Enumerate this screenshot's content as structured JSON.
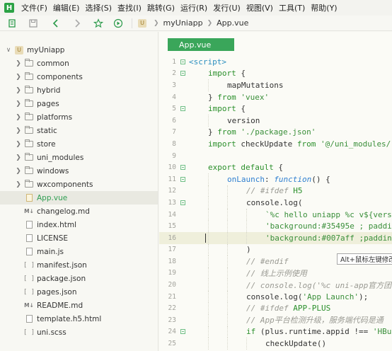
{
  "menubar": {
    "logo": "H",
    "items": [
      "文件(F)",
      "编辑(E)",
      "选择(S)",
      "查找(I)",
      "跳转(G)",
      "运行(R)",
      "发行(U)",
      "视图(V)",
      "工具(T)",
      "帮助(Y)"
    ]
  },
  "toolbar": {
    "icons": [
      "bookmark-icon",
      "save-icon",
      "back-arrow-icon",
      "forward-arrow-icon",
      "star-icon",
      "run-icon"
    ],
    "breadcrumb": {
      "badge": "U",
      "project": "myUniapp",
      "file": "App.vue"
    }
  },
  "sidebar": {
    "root": {
      "label": "myUniapp",
      "expanded": true
    },
    "folders": [
      "common",
      "components",
      "hybrid",
      "pages",
      "platforms",
      "static",
      "store",
      "uni_modules",
      "windows",
      "wxcomponents"
    ],
    "files": [
      {
        "label": "App.vue",
        "icon": "vue-file-icon",
        "selected": true
      },
      {
        "label": "changelog.md",
        "icon": "markdown-file-icon"
      },
      {
        "label": "index.html",
        "icon": "html-file-icon"
      },
      {
        "label": "LICENSE",
        "icon": "file-icon"
      },
      {
        "label": "main.js",
        "icon": "js-file-icon"
      },
      {
        "label": "manifest.json",
        "icon": "json-file-icon"
      },
      {
        "label": "package.json",
        "icon": "json-file-icon"
      },
      {
        "label": "pages.json",
        "icon": "json-file-icon"
      },
      {
        "label": "README.md",
        "icon": "markdown-file-icon"
      },
      {
        "label": "template.h5.html",
        "icon": "html-file-icon"
      },
      {
        "label": "uni.scss",
        "icon": "scss-file-icon"
      }
    ]
  },
  "editor": {
    "tab_label": "App.vue",
    "tooltip": "Alt+鼠标左键修改",
    "current_line": 16,
    "lines": [
      {
        "n": 1,
        "fold": true,
        "indent": 0,
        "parts": [
          [
            "tag",
            "<script>"
          ]
        ]
      },
      {
        "n": 2,
        "fold": true,
        "indent": 1,
        "parts": [
          [
            "kw",
            "import"
          ],
          [
            "txt",
            " {"
          ]
        ]
      },
      {
        "n": 3,
        "fold": false,
        "indent": 2,
        "parts": [
          [
            "txt",
            "mapMutations"
          ]
        ]
      },
      {
        "n": 4,
        "fold": false,
        "indent": 1,
        "parts": [
          [
            "txt",
            "} "
          ],
          [
            "kw",
            "from"
          ],
          [
            "txt",
            " "
          ],
          [
            "str",
            "'vuex'"
          ]
        ]
      },
      {
        "n": 5,
        "fold": true,
        "indent": 1,
        "parts": [
          [
            "kw",
            "import"
          ],
          [
            "txt",
            " {"
          ]
        ]
      },
      {
        "n": 6,
        "fold": false,
        "indent": 2,
        "parts": [
          [
            "txt",
            "version"
          ]
        ]
      },
      {
        "n": 7,
        "fold": false,
        "indent": 1,
        "parts": [
          [
            "txt",
            "} "
          ],
          [
            "kw",
            "from"
          ],
          [
            "txt",
            " "
          ],
          [
            "str",
            "'./package.json'"
          ]
        ]
      },
      {
        "n": 8,
        "fold": false,
        "indent": 1,
        "parts": [
          [
            "kw",
            "import"
          ],
          [
            "txt",
            " checkUpdate "
          ],
          [
            "kw",
            "from"
          ],
          [
            "txt",
            " "
          ],
          [
            "str",
            "'@/uni_modules/"
          ]
        ]
      },
      {
        "n": 9,
        "fold": false,
        "indent": 0,
        "parts": []
      },
      {
        "n": 10,
        "fold": true,
        "indent": 1,
        "parts": [
          [
            "kw",
            "export"
          ],
          [
            "txt",
            " "
          ],
          [
            "kw",
            "default"
          ],
          [
            "txt",
            " {"
          ]
        ]
      },
      {
        "n": 11,
        "fold": true,
        "indent": 2,
        "parts": [
          [
            "def",
            "onLaunch"
          ],
          [
            "txt",
            ": "
          ],
          [
            "fn",
            "function"
          ],
          [
            "txt",
            "() {"
          ]
        ]
      },
      {
        "n": 12,
        "fold": false,
        "indent": 3,
        "parts": [
          [
            "com",
            "// #ifdef "
          ],
          [
            "kw",
            "H5"
          ]
        ]
      },
      {
        "n": 13,
        "fold": true,
        "indent": 3,
        "parts": [
          [
            "txt",
            "console.log("
          ]
        ]
      },
      {
        "n": 14,
        "fold": false,
        "indent": 4,
        "parts": [
          [
            "str",
            "`%c hello uniapp %c v${vers"
          ]
        ]
      },
      {
        "n": 15,
        "fold": false,
        "indent": 4,
        "parts": [
          [
            "str",
            "'background:#35495e ; paddi"
          ]
        ]
      },
      {
        "n": 16,
        "fold": false,
        "indent": 4,
        "parts": [
          [
            "str",
            "'background:#007aff ;paddin"
          ]
        ]
      },
      {
        "n": 17,
        "fold": false,
        "indent": 3,
        "parts": [
          [
            "txt",
            ")"
          ]
        ]
      },
      {
        "n": 18,
        "fold": false,
        "indent": 3,
        "parts": [
          [
            "com",
            "// #endif"
          ]
        ]
      },
      {
        "n": 19,
        "fold": false,
        "indent": 3,
        "parts": [
          [
            "com",
            "// 线上示例使用"
          ]
        ]
      },
      {
        "n": 20,
        "fold": false,
        "indent": 3,
        "parts": [
          [
            "com",
            "// console.log('%c uni-app官方团"
          ]
        ]
      },
      {
        "n": 21,
        "fold": false,
        "indent": 3,
        "parts": [
          [
            "txt",
            "console.log("
          ],
          [
            "str",
            "'App Launch'"
          ],
          [
            "txt",
            ");"
          ]
        ]
      },
      {
        "n": 22,
        "fold": false,
        "indent": 3,
        "parts": [
          [
            "com",
            "// #ifdef "
          ],
          [
            "kw",
            "APP-PLUS"
          ]
        ]
      },
      {
        "n": 23,
        "fold": false,
        "indent": 3,
        "parts": [
          [
            "com",
            "// App平台检测升级，服务端代码是通"
          ]
        ]
      },
      {
        "n": 24,
        "fold": true,
        "indent": 3,
        "parts": [
          [
            "kw",
            "if"
          ],
          [
            "txt",
            " (plus.runtime.appid !== "
          ],
          [
            "str",
            "'HBu"
          ]
        ]
      },
      {
        "n": 25,
        "fold": false,
        "indent": 4,
        "parts": [
          [
            "txt",
            "checkUpdate()"
          ]
        ]
      }
    ]
  },
  "colors": {
    "accent": "#3aa65a",
    "background": "#f8f8f3",
    "current_line": "#efefdb"
  }
}
